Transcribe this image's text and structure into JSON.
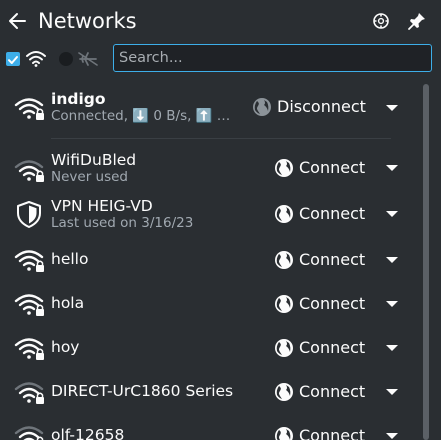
{
  "header": {
    "title": "Networks",
    "back_icon": "go-back-arrow-icon",
    "configure_icon": "network-configure-icon",
    "pin_icon": "pin-icon"
  },
  "toolbar": {
    "wifi_enabled": true,
    "airplane_mode": false,
    "search_placeholder": "Search..."
  },
  "networks": [
    {
      "name": "indigo",
      "status": "Connected, ⬇️ 0 B/s, ⬆️ …",
      "action": "Disconnect",
      "icon": "wifi-secured-icon",
      "bold": true,
      "active": true
    },
    {
      "name": "WifiDuBled",
      "status": "Never used",
      "action": "Connect",
      "icon": "wifi-secured-icon"
    },
    {
      "name": "VPN HEIG-VD",
      "status": "Last used on 3/16/23",
      "action": "Connect",
      "icon": "vpn-shield-icon"
    },
    {
      "name": "hello",
      "status": "",
      "action": "Connect",
      "icon": "wifi-secured-icon"
    },
    {
      "name": "hola",
      "status": "",
      "action": "Connect",
      "icon": "wifi-secured-icon"
    },
    {
      "name": "hoy",
      "status": "",
      "action": "Connect",
      "icon": "wifi-secured-icon"
    },
    {
      "name": "DIRECT-UrC1860 Series",
      "status": "",
      "action": "Connect",
      "icon": "wifi-secured-icon"
    },
    {
      "name": "olf-12658",
      "status": "",
      "action": "Connect",
      "icon": "wifi-secured-icon"
    }
  ],
  "colors": {
    "background": "#2a2e32",
    "accent": "#3daee9",
    "text": "#fcfcfc",
    "subtext": "#a1a9b1"
  }
}
